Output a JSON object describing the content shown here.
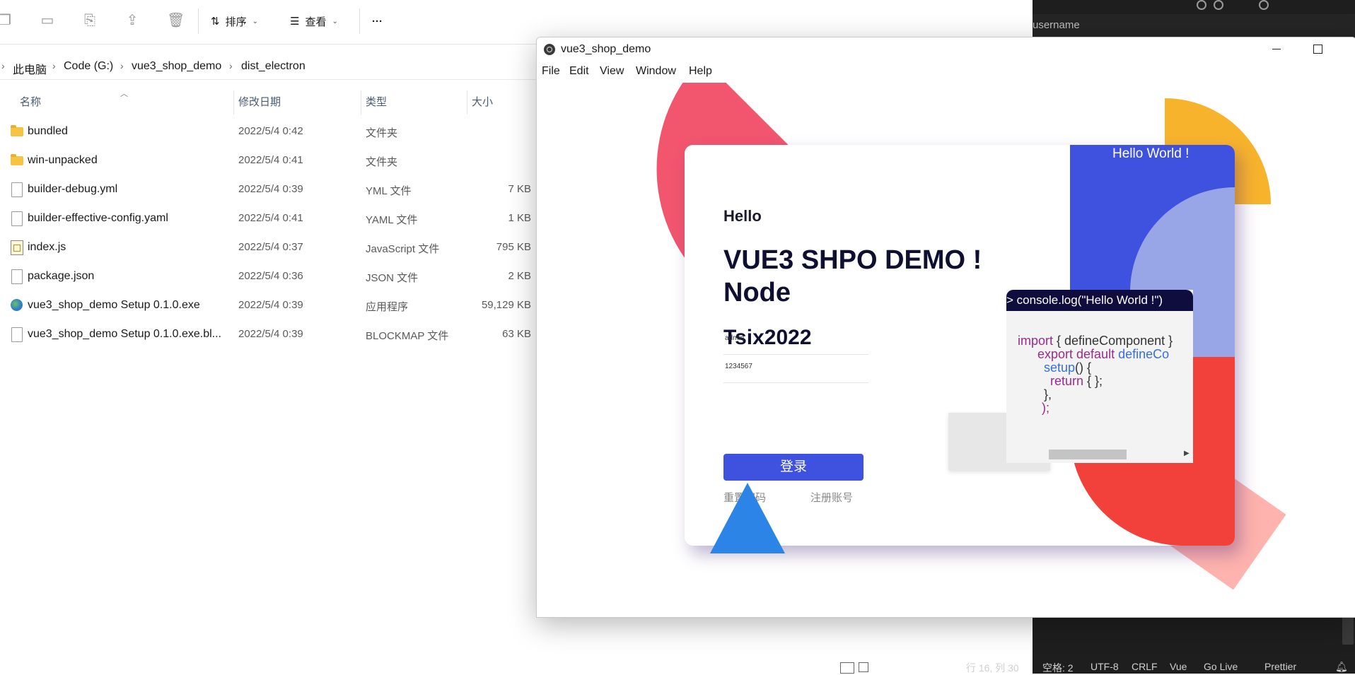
{
  "editor": {
    "panel_label": "username",
    "status": [
      "行 16, 列 30",
      "空格: 2",
      "UTF-8",
      "CRLF",
      "Vue",
      "Go Live",
      "Prettier"
    ]
  },
  "explorer": {
    "toolbar": {
      "sort_label": "排序",
      "view_label": "查看",
      "more_label": "···"
    },
    "breadcrumb": [
      "此电脑",
      "Code (G:)",
      "vue3_shop_demo",
      "dist_electron"
    ],
    "columns": {
      "name": "名称",
      "date": "修改日期",
      "type": "类型",
      "size": "大小"
    },
    "files": [
      {
        "name": "bundled",
        "date": "2022/5/4 0:42",
        "type": "文件夹",
        "size": "",
        "icon": "folder-icon"
      },
      {
        "name": "win-unpacked",
        "date": "2022/5/4 0:41",
        "type": "文件夹",
        "size": "",
        "icon": "folder-icon"
      },
      {
        "name": "builder-debug.yml",
        "date": "2022/5/4 0:39",
        "type": "YML 文件",
        "size": "7 KB",
        "icon": "document-icon"
      },
      {
        "name": "builder-effective-config.yaml",
        "date": "2022/5/4 0:41",
        "type": "YAML 文件",
        "size": "1 KB",
        "icon": "document-icon"
      },
      {
        "name": "index.js",
        "date": "2022/5/4 0:37",
        "type": "JavaScript 文件",
        "size": "795 KB",
        "icon": "javascript-file-icon"
      },
      {
        "name": "package.json",
        "date": "2022/5/4 0:36",
        "type": "JSON 文件",
        "size": "2 KB",
        "icon": "document-icon"
      },
      {
        "name": "vue3_shop_demo Setup 0.1.0.exe",
        "date": "2022/5/4 0:39",
        "type": "应用程序",
        "size": "59,129 KB",
        "icon": "installer-icon"
      },
      {
        "name": "vue3_shop_demo Setup 0.1.0.exe.bl...",
        "date": "2022/5/4 0:39",
        "type": "BLOCKMAP 文件",
        "size": "63 KB",
        "icon": "document-icon"
      }
    ]
  },
  "app": {
    "title": "vue3_shop_demo",
    "menu": [
      "File",
      "Edit",
      "View",
      "Window",
      "Help"
    ],
    "card": {
      "hello": "Hello",
      "title_line1": "VUE3 SHPO DEMO !",
      "title_line2": "Node",
      "subtitle": "Tsix2022",
      "username_value": "admin",
      "password_value": "1234567",
      "login_label": "登录",
      "reset_link": "重置密码",
      "register_link": "注册账号",
      "hello_world": "Hello World !"
    },
    "code": {
      "header": "> console.log(\"Hello World !\")",
      "line1_kw": "import",
      "line1_rest": " { defineComponent }",
      "line2_kw": "export default",
      "line2_fn": " defineCo",
      "line3_fn": "setup",
      "line3_rest": "() {",
      "line4_kw": "return",
      "line4_rest": " { };",
      "line5": "},",
      "line6": ");"
    },
    "colors": {
      "primary": "#3f51df",
      "accent_red": "#f2413a",
      "accent_pink": "#f2566e",
      "accent_yellow": "#f8b32d",
      "accent_blue": "#2b84e6"
    }
  }
}
